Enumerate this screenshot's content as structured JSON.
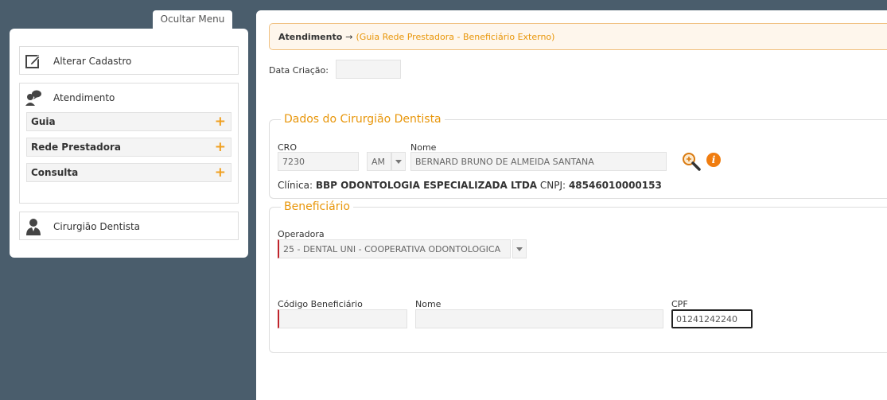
{
  "sidebar": {
    "toggle_label": "Ocultar Menu",
    "alterar_cadastro": "Alterar Cadastro",
    "atendimento": {
      "label": "Atendimento",
      "items": [
        {
          "label": "Guia"
        },
        {
          "label": "Rede Prestadora"
        },
        {
          "label": "Consulta"
        }
      ]
    },
    "cirurgiao_dentista": "Cirurgião Dentista"
  },
  "breadcrumb": {
    "main": "Atendimento",
    "arrow": "→",
    "sub": "(Guia Rede Prestadora - Beneficiário Externo)"
  },
  "form": {
    "data_criacao_label": "Data Criação:",
    "data_criacao_value": "",
    "dentista": {
      "legend": "Dados do Cirurgião Dentista",
      "cro_label": "CRO",
      "cro_value": "7230",
      "uf_value": "AM",
      "nome_label": "Nome",
      "nome_value": "BERNARD BRUNO DE ALMEIDA SANTANA",
      "clinica_label": "Clínica:",
      "clinica_value": "BBP ODONTOLOGIA ESPECIALIZADA LTDA",
      "cnpj_label": "CNPJ:",
      "cnpj_value": "48546010000153"
    },
    "beneficiario": {
      "legend": "Beneficiário",
      "operadora_label": "Operadora",
      "operadora_value": "25 - DENTAL UNI - COOPERATIVA ODONTOLOGICA",
      "codigo_label": "Código Beneficiário",
      "codigo_value": "",
      "nome_label": "Nome",
      "nome_value": "",
      "cpf_label": "CPF",
      "cpf_value": "01241242240"
    }
  },
  "icons": {
    "search": "magnifier-icon",
    "info": "info-icon",
    "info_glyph": "i"
  },
  "colors": {
    "accent": "#e8960a",
    "required": "#c0242c",
    "sidebar_bg": "#4a5d6c"
  }
}
